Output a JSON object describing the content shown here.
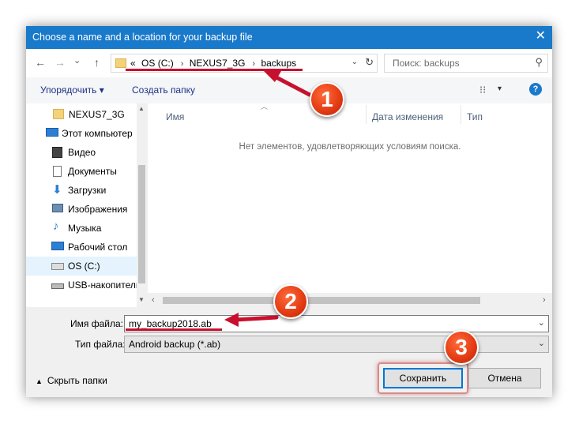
{
  "window": {
    "title": "Choose a name and a location for your backup file",
    "close_glyph": "✕"
  },
  "nav": {
    "back": "←",
    "forward": "→",
    "recent": "⌄",
    "up": "↑"
  },
  "address": {
    "prefix": "«",
    "crumbs": [
      "OS (C:)",
      "NEXUS7_3G",
      "backups"
    ],
    "separator": "›",
    "dropdown": "⌄",
    "refresh": "↻"
  },
  "search": {
    "placeholder": "Поиск: backups",
    "icon": "⚲"
  },
  "toolbar": {
    "organize": "Упорядочить ▾",
    "new_folder": "Создать папку",
    "view_icon": "⁝⁝",
    "view_drop": "▾",
    "help": "?"
  },
  "sidebar": {
    "items": [
      {
        "label": "NEXUS7_3G",
        "icon": "folder-icon"
      },
      {
        "label": "Этот компьютер",
        "icon": "computer-icon"
      },
      {
        "label": "Видео",
        "icon": "video-icon"
      },
      {
        "label": "Документы",
        "icon": "documents-icon"
      },
      {
        "label": "Загрузки",
        "icon": "downloads-icon"
      },
      {
        "label": "Изображения",
        "icon": "pictures-icon"
      },
      {
        "label": "Музыка",
        "icon": "music-icon"
      },
      {
        "label": "Рабочий стол",
        "icon": "desktop-icon"
      },
      {
        "label": "OS (C:)",
        "icon": "drive-icon",
        "selected": true
      },
      {
        "label": "USB-накопители",
        "icon": "usb-drive-icon"
      }
    ]
  },
  "filelist": {
    "columns": [
      "Имя",
      "Дата изменения",
      "Тип"
    ],
    "empty_message": "Нет элементов, удовлетворяющих условиям поиска."
  },
  "form": {
    "filename_label": "Имя файла:",
    "filename_value": "my_backup2018.ab",
    "filetype_label": "Тип файла:",
    "filetype_value": "Android backup (*.ab)"
  },
  "footer": {
    "hide_folders": "Скрыть папки",
    "save": "Сохранить",
    "cancel": "Отмена"
  },
  "annotations": {
    "badges": [
      "1",
      "2",
      "3"
    ],
    "color": "#c8102e"
  }
}
